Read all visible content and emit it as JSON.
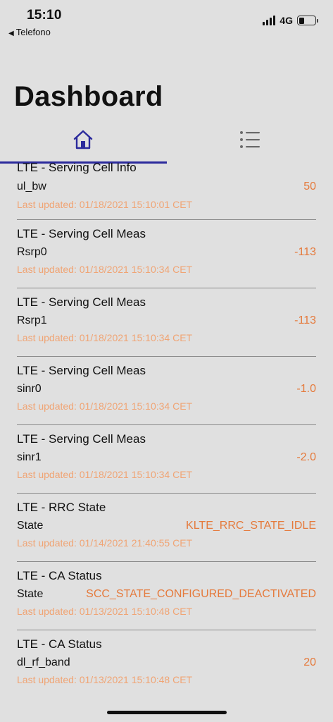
{
  "status_bar": {
    "time": "15:10",
    "back_app": "Telefono",
    "network": "4G",
    "battery_level": 0.35
  },
  "page": {
    "title": "Dashboard"
  },
  "tabs": [
    {
      "icon": "home-icon",
      "selected": true
    },
    {
      "icon": "list-icon",
      "selected": false
    }
  ],
  "items": [
    {
      "title": "LTE - Serving Cell Info",
      "key": "ul_bw",
      "value": "50",
      "updated": "Last updated: 01/18/2021 15:10:01 CET"
    },
    {
      "title": "LTE - Serving Cell Meas",
      "key": "Rsrp0",
      "value": "-113",
      "updated": "Last updated: 01/18/2021 15:10:34 CET"
    },
    {
      "title": "LTE - Serving Cell Meas",
      "key": "Rsrp1",
      "value": "-113",
      "updated": "Last updated: 01/18/2021 15:10:34 CET"
    },
    {
      "title": "LTE - Serving Cell Meas",
      "key": "sinr0",
      "value": "-1.0",
      "updated": "Last updated: 01/18/2021 15:10:34 CET"
    },
    {
      "title": "LTE - Serving Cell Meas",
      "key": "sinr1",
      "value": "-2.0",
      "updated": "Last updated: 01/18/2021 15:10:34 CET"
    },
    {
      "title": "LTE - RRC State",
      "key": "State",
      "value": "KLTE_RRC_STATE_IDLE",
      "updated": "Last updated: 01/14/2021 21:40:55 CET"
    },
    {
      "title": "LTE - CA Status",
      "key": "State",
      "value": "SCC_STATE_CONFIGURED_DEACTIVATED",
      "updated": "Last updated: 01/13/2021 15:10:48 CET"
    },
    {
      "title": "LTE - CA Status",
      "key": "dl_rf_band",
      "value": "20",
      "updated": "Last updated: 01/13/2021 15:10:48 CET"
    }
  ],
  "colors": {
    "accent": "#2b2a9c",
    "value": "#e57a3c",
    "updated": "#f0a474",
    "background": "#e0e0e0"
  }
}
